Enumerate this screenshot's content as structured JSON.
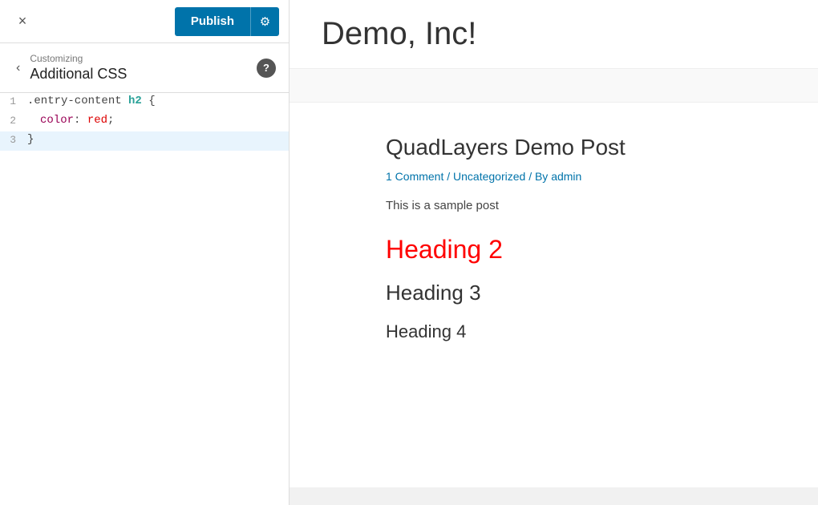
{
  "topbar": {
    "close_icon": "×",
    "publish_label": "Publish",
    "gear_icon": "⚙"
  },
  "customizing": {
    "back_icon": "‹",
    "label": "Customizing",
    "title": "Additional CSS",
    "help_icon": "?"
  },
  "code_editor": {
    "lines": [
      {
        "number": "1",
        "content_html": "<span class='css-selector'>.entry-content </span><span class='css-selector' style='color:#2aa198;font-weight:bold;'>h2</span><span class='css-punct'> {</span>"
      },
      {
        "number": "2",
        "content_html": "  <span class='css-property'>color</span><span class='css-punct'>: </span><span class='css-value'>red</span><span class='css-punct'>;</span>"
      },
      {
        "number": "3",
        "content_html": "<span class='css-brace'>}</span>",
        "active": true
      }
    ]
  },
  "preview": {
    "site_title": "Demo, Inc!",
    "post_title": "QuadLayers Demo Post",
    "post_meta": "1 Comment / Uncategorized / By admin",
    "post_excerpt": "This is a sample post",
    "heading2": "Heading 2",
    "heading3": "Heading 3",
    "heading4": "Heading 4"
  }
}
